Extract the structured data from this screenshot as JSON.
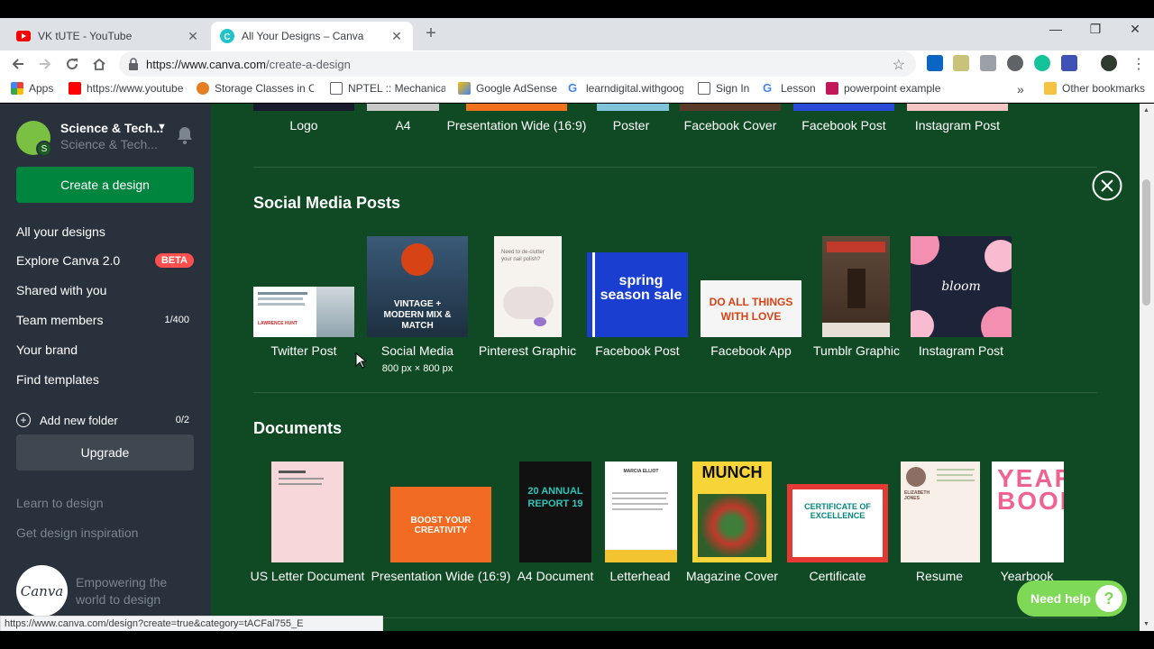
{
  "browser": {
    "tabs": [
      {
        "title": "VK tUTE - YouTube",
        "icon": "youtube-icon"
      },
      {
        "title": "All Your Designs – Canva",
        "icon": "canva-icon"
      }
    ],
    "url_host": "https://www.canva.com",
    "url_path": "/create-a-design",
    "bookmarks": [
      {
        "label": "Apps",
        "icon": "apps-icon",
        "color": "#4285f4"
      },
      {
        "label": "https://www.youtube",
        "icon": "youtube-icon",
        "color": "#ff0000"
      },
      {
        "label": "Storage Classes in C",
        "icon": "site-icon",
        "color": "#e67e22"
      },
      {
        "label": "NPTEL :: Mechanical",
        "icon": "page-icon",
        "color": "#ffffff"
      },
      {
        "label": "Google AdSense",
        "icon": "adsense-icon",
        "color": "#fbbc05"
      },
      {
        "label": "learndigital.withgoog",
        "icon": "google-icon",
        "color": "#4285f4"
      },
      {
        "label": "Sign In",
        "icon": "page-icon",
        "color": "#ffffff"
      },
      {
        "label": "Lesson",
        "icon": "google-icon",
        "color": "#4285f4"
      },
      {
        "label": "powerpoint example",
        "icon": "site-icon",
        "color": "#c2185b"
      }
    ],
    "other_bookmarks": "Other bookmarks",
    "status_url": "https://www.canva.com/design?create=true&category=tACFal755_E"
  },
  "sidebar": {
    "team_name": "Science & Tech...",
    "team_sub": "Science & Tech...",
    "avatar_letter": "S",
    "create_label": "Create a design",
    "items": [
      {
        "label": "All your designs"
      },
      {
        "label": "Explore Canva 2.0",
        "badge": "BETA"
      },
      {
        "label": "Shared with you"
      },
      {
        "label": "Team members",
        "count": "1/400"
      },
      {
        "label": "Your brand"
      },
      {
        "label": "Find templates"
      }
    ],
    "add_folder": "Add new folder",
    "folder_count": "0/2",
    "upgrade_label": "Upgrade",
    "learn": "Learn to design",
    "inspire": "Get design inspiration",
    "logo_text": "Canva",
    "tagline_1": "Empowering the",
    "tagline_2": "world to design"
  },
  "main": {
    "top_row": [
      "Logo",
      "A4",
      "Presentation Wide (16:9)",
      "Poster",
      "Facebook Cover",
      "Facebook Post",
      "Instagram Post"
    ],
    "social_title": "Social Media Posts",
    "social": [
      {
        "label": "Twitter Post",
        "thumb_text": "LAWRENCE HUNT"
      },
      {
        "label": "Social Media",
        "sub": "800 px × 800 px",
        "thumb_text": "VINTAGE + MODERN MIX & MATCH"
      },
      {
        "label": "Pinterest Graphic",
        "thumb_text": "Need to de-clutter your nail polish?"
      },
      {
        "label": "Facebook Post",
        "thumb_text": "spring season sale"
      },
      {
        "label": "Facebook App",
        "thumb_text": "DO ALL THINGS WITH LOVE"
      },
      {
        "label": "Tumblr Graphic",
        "thumb_text": ""
      },
      {
        "label": "Instagram Post",
        "thumb_text": "bloom"
      }
    ],
    "docs_title": "Documents",
    "docs": [
      {
        "label": "US Letter Document",
        "thumb_text": ""
      },
      {
        "label": "Presentation Wide (16:9)",
        "thumb_text": "BOOST YOUR CREATIVITY"
      },
      {
        "label": "A4 Document",
        "thumb_text": "20 ANNUAL REPORT 19"
      },
      {
        "label": "Letterhead",
        "thumb_text": "MARCIA ELLIOT"
      },
      {
        "label": "Magazine Cover",
        "thumb_text": "MUNCH"
      },
      {
        "label": "Certificate",
        "thumb_text": "CERTIFICATE OF EXCELLENCE"
      },
      {
        "label": "Resume",
        "thumb_text": "ELIZABETH JONES"
      },
      {
        "label": "Yearbook",
        "thumb_text": "YEAR BOOK"
      }
    ],
    "need_help": "Need help",
    "help_q": "?"
  }
}
